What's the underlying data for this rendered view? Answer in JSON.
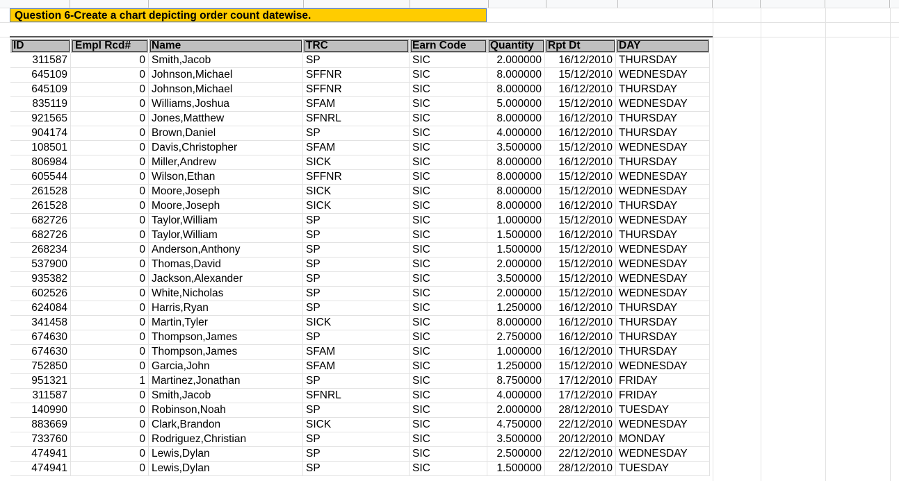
{
  "question": "Question 6-Create a chart depicting order count datewise.",
  "columns": [
    "ID",
    "Empl Rcd#",
    "Name",
    "TRC",
    "Earn Code",
    "Quantity",
    "Rpt Dt",
    "DAY"
  ],
  "rows": [
    [
      "311587",
      "0",
      "Smith,Jacob",
      "SP",
      "SIC",
      "2.000000",
      "16/12/2010",
      "THURSDAY"
    ],
    [
      "645109",
      "0",
      "Johnson,Michael",
      "SFFNR",
      "SIC",
      "8.000000",
      "15/12/2010",
      "WEDNESDAY"
    ],
    [
      "645109",
      "0",
      "Johnson,Michael",
      "SFFNR",
      "SIC",
      "8.000000",
      "16/12/2010",
      "THURSDAY"
    ],
    [
      "835119",
      "0",
      "Williams,Joshua",
      "SFAM",
      "SIC",
      "5.000000",
      "15/12/2010",
      "WEDNESDAY"
    ],
    [
      "921565",
      "0",
      "Jones,Matthew",
      "SFNRL",
      "SIC",
      "8.000000",
      "16/12/2010",
      "THURSDAY"
    ],
    [
      "904174",
      "0",
      "Brown,Daniel",
      "SP",
      "SIC",
      "4.000000",
      "16/12/2010",
      "THURSDAY"
    ],
    [
      "108501",
      "0",
      "Davis,Christopher",
      "SFAM",
      "SIC",
      "3.500000",
      "15/12/2010",
      "WEDNESDAY"
    ],
    [
      "806984",
      "0",
      "Miller,Andrew",
      "SICK",
      "SIC",
      "8.000000",
      "16/12/2010",
      "THURSDAY"
    ],
    [
      "605544",
      "0",
      "Wilson,Ethan",
      "SFFNR",
      "SIC",
      "8.000000",
      "15/12/2010",
      "WEDNESDAY"
    ],
    [
      "261528",
      "0",
      "Moore,Joseph",
      "SICK",
      "SIC",
      "8.000000",
      "15/12/2010",
      "WEDNESDAY"
    ],
    [
      "261528",
      "0",
      "Moore,Joseph",
      "SICK",
      "SIC",
      "8.000000",
      "16/12/2010",
      "THURSDAY"
    ],
    [
      "682726",
      "0",
      "Taylor,William",
      "SP",
      "SIC",
      "1.000000",
      "15/12/2010",
      "WEDNESDAY"
    ],
    [
      "682726",
      "0",
      "Taylor,William",
      "SP",
      "SIC",
      "1.500000",
      "16/12/2010",
      "THURSDAY"
    ],
    [
      "268234",
      "0",
      "Anderson,Anthony",
      "SP",
      "SIC",
      "1.500000",
      "15/12/2010",
      "WEDNESDAY"
    ],
    [
      "537900",
      "0",
      "Thomas,David",
      "SP",
      "SIC",
      "2.000000",
      "15/12/2010",
      "WEDNESDAY"
    ],
    [
      "935382",
      "0",
      "Jackson,Alexander",
      "SP",
      "SIC",
      "3.500000",
      "15/12/2010",
      "WEDNESDAY"
    ],
    [
      "602526",
      "0",
      "White,Nicholas",
      "SP",
      "SIC",
      "2.000000",
      "15/12/2010",
      "WEDNESDAY"
    ],
    [
      "624084",
      "0",
      "Harris,Ryan",
      "SP",
      "SIC",
      "1.250000",
      "16/12/2010",
      "THURSDAY"
    ],
    [
      "341458",
      "0",
      "Martin,Tyler",
      "SICK",
      "SIC",
      "8.000000",
      "16/12/2010",
      "THURSDAY"
    ],
    [
      "674630",
      "0",
      "Thompson,James",
      "SP",
      "SIC",
      "2.750000",
      "16/12/2010",
      "THURSDAY"
    ],
    [
      "674630",
      "0",
      "Thompson,James",
      "SFAM",
      "SIC",
      "1.000000",
      "16/12/2010",
      "THURSDAY"
    ],
    [
      "752850",
      "0",
      "Garcia,John",
      "SFAM",
      "SIC",
      "1.250000",
      "15/12/2010",
      "WEDNESDAY"
    ],
    [
      "951321",
      "1",
      "Martinez,Jonathan",
      "SP",
      "SIC",
      "8.750000",
      "17/12/2010",
      "FRIDAY"
    ],
    [
      "311587",
      "0",
      "Smith,Jacob",
      "SFNRL",
      "SIC",
      "4.000000",
      "17/12/2010",
      "FRIDAY"
    ],
    [
      "140990",
      "0",
      "Robinson,Noah",
      "SP",
      "SIC",
      "2.000000",
      "28/12/2010",
      "TUESDAY"
    ],
    [
      "883669",
      "0",
      "Clark,Brandon",
      "SICK",
      "SIC",
      "4.750000",
      "22/12/2010",
      "WEDNESDAY"
    ],
    [
      "733760",
      "0",
      "Rodriguez,Christian",
      "SP",
      "SIC",
      "3.500000",
      "20/12/2010",
      "MONDAY"
    ],
    [
      "474941",
      "0",
      "Lewis,Dylan",
      "SP",
      "SIC",
      "2.500000",
      "22/12/2010",
      "WEDNESDAY"
    ],
    [
      "474941",
      "0",
      "Lewis,Dylan",
      "SP",
      "SIC",
      "1.500000",
      "28/12/2010",
      "TUESDAY"
    ]
  ],
  "colors": {
    "question_fill": "#ffcc00",
    "header_fill": "#c0c0c0",
    "gridline": "#e2e2e2"
  }
}
